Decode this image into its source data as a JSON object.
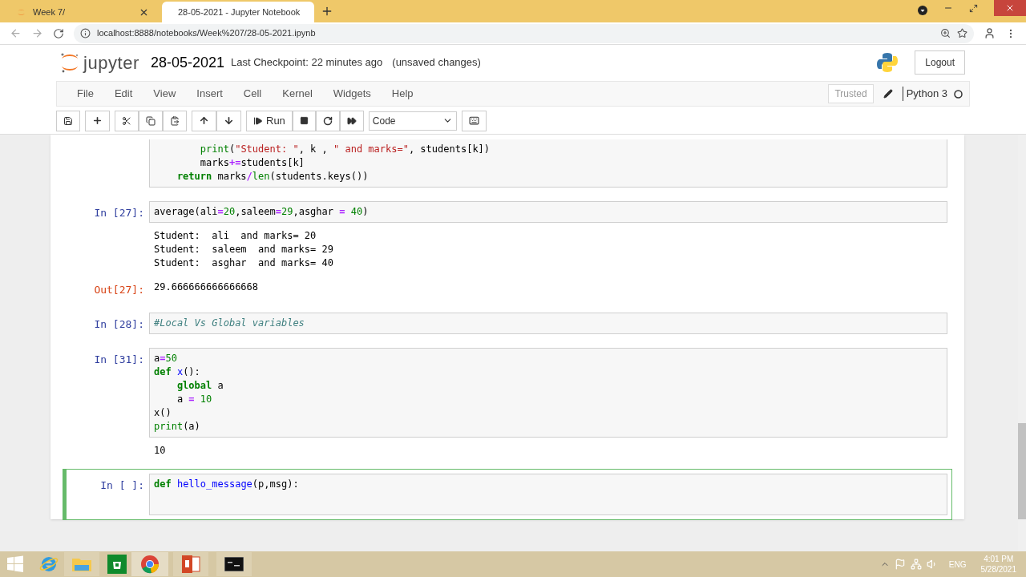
{
  "browser": {
    "tabs": [
      {
        "label": "Week 7/",
        "selected": false
      },
      {
        "label": "28-05-2021 - Jupyter Notebook",
        "selected": true
      }
    ],
    "url": "localhost:8888/notebooks/Week%207/28-05-2021.ipynb"
  },
  "header": {
    "logo_text": "jupyter",
    "notebook_name": "28-05-2021",
    "checkpoint": "Last Checkpoint: 22 minutes ago",
    "unsaved": "(unsaved changes)",
    "logout": "Logout"
  },
  "menu": [
    "File",
    "Edit",
    "View",
    "Insert",
    "Cell",
    "Kernel",
    "Widgets",
    "Help"
  ],
  "kernel": {
    "trusted": "Trusted",
    "name": "Python 3"
  },
  "toolbar": {
    "run": "Run",
    "cell_type": "Code"
  },
  "cells": [
    {
      "selected": false,
      "lines": [
        [
          {
            "kind": "builtin",
            "t": "        print"
          },
          {
            "kind": "plain",
            "t": "("
          },
          {
            "kind": "string",
            "t": "\"Student: \""
          },
          {
            "kind": "plain",
            "t": ", k , "
          },
          {
            "kind": "string",
            "t": "\" and marks=\""
          },
          {
            "kind": "plain",
            "t": ", students[k])"
          }
        ],
        [
          {
            "kind": "plain",
            "t": "        marks"
          },
          {
            "kind": "op",
            "t": "+="
          },
          {
            "kind": "plain",
            "t": "students[k]"
          }
        ],
        [
          {
            "kind": "kw",
            "t": "    return"
          },
          {
            "kind": "plain",
            "t": " marks"
          },
          {
            "kind": "op",
            "t": "/"
          },
          {
            "kind": "builtin",
            "t": "len"
          },
          {
            "kind": "plain",
            "t": "(students.keys())"
          }
        ]
      ]
    },
    {
      "prompt": "In [27]:",
      "selected": false,
      "lines": [
        [
          {
            "kind": "plain",
            "t": "average(ali"
          },
          {
            "kind": "op",
            "t": "="
          },
          {
            "kind": "num",
            "t": "20"
          },
          {
            "kind": "plain",
            "t": ",saleem"
          },
          {
            "kind": "op",
            "t": "="
          },
          {
            "kind": "num",
            "t": "29"
          },
          {
            "kind": "plain",
            "t": ",asghar "
          },
          {
            "kind": "op",
            "t": "="
          },
          {
            "kind": "num",
            "t": " 40"
          },
          {
            "kind": "plain",
            "t": ")"
          }
        ]
      ],
      "stream": [
        "Student:  ali  and marks= 20",
        "Student:  saleem  and marks= 29",
        "Student:  asghar  and marks= 40"
      ],
      "out_prompt": "Out[27]:",
      "result": "29.666666666666668"
    },
    {
      "prompt": "In [28]:",
      "selected": false,
      "lines": [
        [
          {
            "kind": "comment",
            "t": "#Local Vs Global variables"
          }
        ]
      ]
    },
    {
      "prompt": "In [31]:",
      "selected": false,
      "lines": [
        [
          {
            "kind": "plain",
            "t": "a"
          },
          {
            "kind": "op",
            "t": "="
          },
          {
            "kind": "num",
            "t": "50"
          }
        ],
        [
          {
            "kind": "kw",
            "t": "def "
          },
          {
            "kind": "defname",
            "t": "x"
          },
          {
            "kind": "plain",
            "t": "():"
          }
        ],
        [
          {
            "kind": "kw",
            "t": "    global"
          },
          {
            "kind": "plain",
            "t": " a"
          }
        ],
        [
          {
            "kind": "plain",
            "t": "    a "
          },
          {
            "kind": "op",
            "t": "="
          },
          {
            "kind": "num",
            "t": " 10"
          }
        ],
        [
          {
            "kind": "plain",
            "t": "x()"
          }
        ],
        [
          {
            "kind": "builtin",
            "t": "print"
          },
          {
            "kind": "plain",
            "t": "(a)"
          }
        ]
      ],
      "stream": [
        "10"
      ]
    },
    {
      "prompt": "In [ ]:",
      "selected": true,
      "lines": [
        [
          {
            "kind": "kw",
            "t": "def "
          },
          {
            "kind": "defname",
            "t": "hello_message"
          },
          {
            "kind": "plain",
            "t": "(p,msg):"
          }
        ]
      ]
    }
  ],
  "taskbar": {
    "language": "ENG",
    "time": "4:01 PM",
    "date": "5/28/2021"
  }
}
